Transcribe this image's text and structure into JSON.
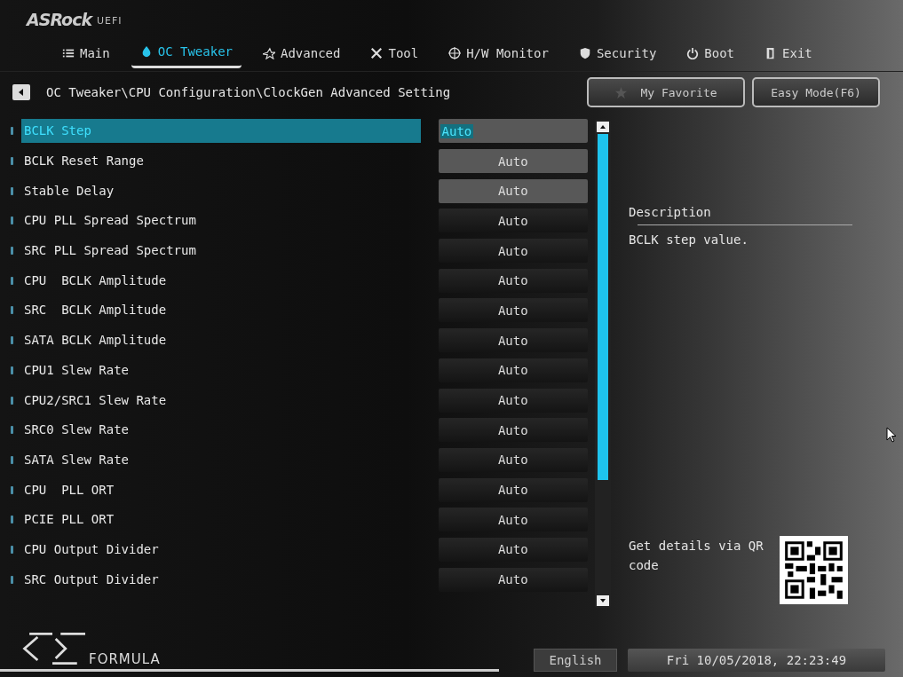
{
  "header": {
    "brand": "ASRock",
    "brand_suffix": "UEFI"
  },
  "tabs": [
    {
      "label": "Main",
      "selected": false
    },
    {
      "label": "OC Tweaker",
      "selected": true
    },
    {
      "label": "Advanced",
      "selected": false
    },
    {
      "label": "Tool",
      "selected": false
    },
    {
      "label": "H/W Monitor",
      "selected": false
    },
    {
      "label": "Security",
      "selected": false
    },
    {
      "label": "Boot",
      "selected": false
    },
    {
      "label": "Exit",
      "selected": false
    }
  ],
  "breadcrumb": "OC Tweaker\\CPU Configuration\\ClockGen Advanced Setting",
  "buttons": [
    {
      "label": "My Favorite",
      "kind": "favorite"
    },
    {
      "label": "Easy Mode(F6)",
      "kind": "plain"
    }
  ],
  "settings": [
    {
      "name": "BCLK Step",
      "value": "Auto",
      "selected": true,
      "lit": true
    },
    {
      "name": "BCLK Reset Range",
      "value": "Auto",
      "selected": false,
      "lit": true
    },
    {
      "name": "Stable Delay",
      "value": "Auto",
      "selected": false,
      "lit": true
    },
    {
      "name": "CPU PLL Spread Spectrum",
      "value": "Auto",
      "selected": false,
      "lit": false
    },
    {
      "name": "SRC PLL Spread Spectrum",
      "value": "Auto",
      "selected": false,
      "lit": false
    },
    {
      "name": "CPU  BCLK Amplitude",
      "value": "Auto",
      "selected": false,
      "lit": false
    },
    {
      "name": "SRC  BCLK Amplitude",
      "value": "Auto",
      "selected": false,
      "lit": false
    },
    {
      "name": "SATA BCLK Amplitude",
      "value": "Auto",
      "selected": false,
      "lit": false
    },
    {
      "name": "CPU1 Slew Rate",
      "value": "Auto",
      "selected": false,
      "lit": false
    },
    {
      "name": "CPU2/SRC1 Slew Rate",
      "value": "Auto",
      "selected": false,
      "lit": false
    },
    {
      "name": "SRC0 Slew Rate",
      "value": "Auto",
      "selected": false,
      "lit": false
    },
    {
      "name": "SATA Slew Rate",
      "value": "Auto",
      "selected": false,
      "lit": false
    },
    {
      "name": "CPU  PLL ORT",
      "value": "Auto",
      "selected": false,
      "lit": false
    },
    {
      "name": "PCIE PLL ORT",
      "value": "Auto",
      "selected": false,
      "lit": false
    },
    {
      "name": "CPU Output Divider",
      "value": "Auto",
      "selected": false,
      "lit": false
    },
    {
      "name": "SRC Output Divider",
      "value": "Auto",
      "selected": false,
      "lit": false
    }
  ],
  "description": {
    "title": "Description",
    "text": "BCLK step value.",
    "qr_text": "Get details via QR code"
  },
  "footer": {
    "logo_text": "FORMULA",
    "language": "English",
    "datetime": "Fri 10/05/2018, 22:23:49"
  }
}
